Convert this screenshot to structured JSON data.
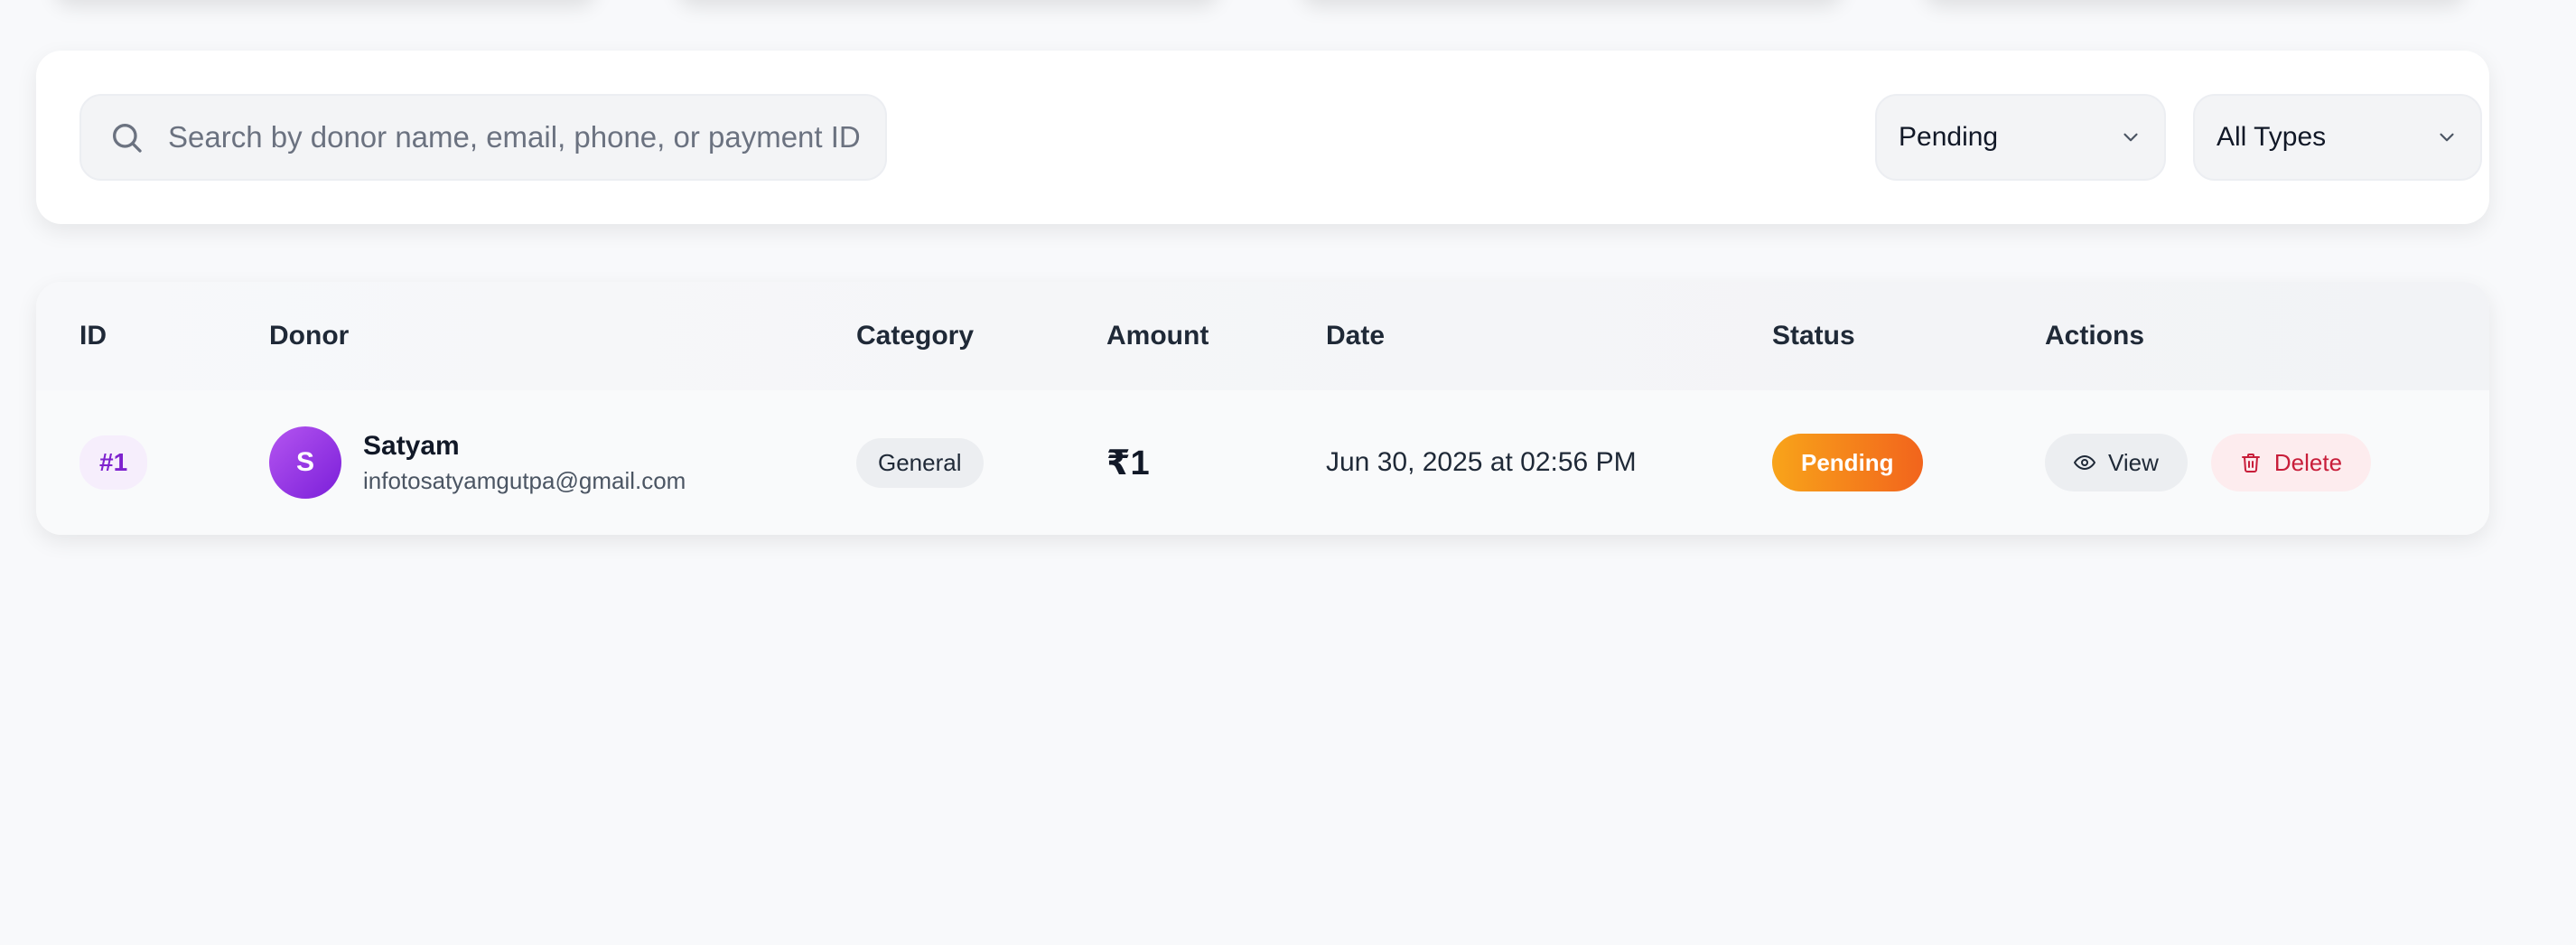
{
  "search": {
    "placeholder": "Search by donor name, email, phone, or payment ID",
    "value": ""
  },
  "filters": {
    "status_selected": "Pending",
    "type_selected": "All Types"
  },
  "table": {
    "columns": [
      "ID",
      "Donor",
      "Category",
      "Amount",
      "Date",
      "Status",
      "Actions"
    ],
    "rows": [
      {
        "id": "#1",
        "avatar_initial": "S",
        "donor_name": "Satyam",
        "donor_email": "infotosatyamgutpa@gmail.com",
        "category": "General",
        "amount": "₹1",
        "date": "Jun 30, 2025 at 02:56 PM",
        "status": "Pending",
        "view_label": "View",
        "delete_label": "Delete"
      }
    ]
  },
  "colors": {
    "accent_purple": "#7e22ce",
    "status_pending_start": "#f8a41a",
    "status_pending_end": "#f2641c",
    "delete_red": "#c81e3a"
  },
  "icons": {
    "search": "search-icon",
    "dropdown": "chevron-down-icon",
    "view": "eye-icon",
    "delete": "trash-icon"
  }
}
